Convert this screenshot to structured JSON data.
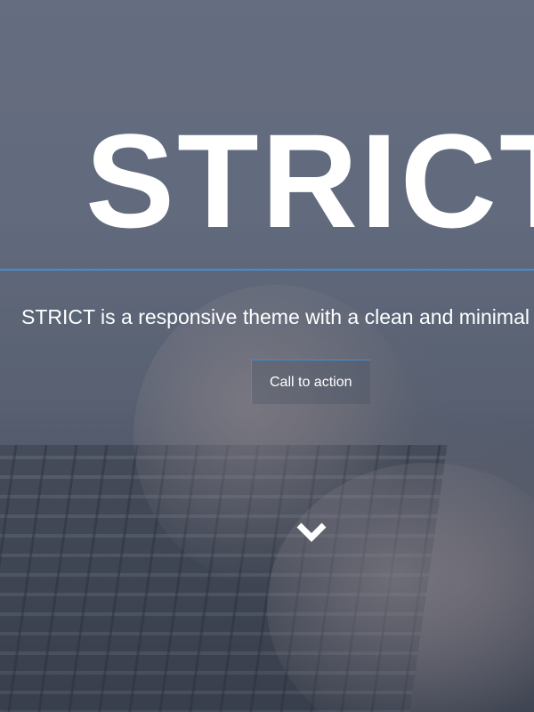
{
  "hero": {
    "title": "STRICT",
    "tagline": "STRICT is a responsive theme with a clean and minimal",
    "cta_label": "Call to action",
    "scroll_icon": "chevron-down-icon"
  },
  "colors": {
    "accent": "#3d8fd6",
    "text": "#ffffff",
    "overlay": "#525c73"
  }
}
